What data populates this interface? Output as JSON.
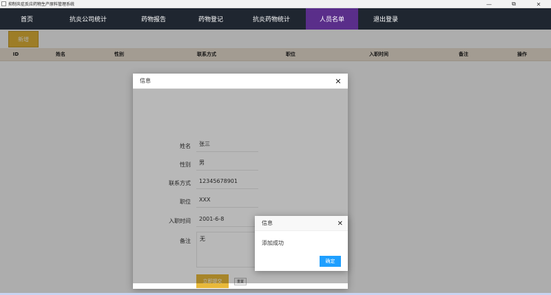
{
  "window": {
    "title": "抑制炎症反应药物生产原料管理系统",
    "controls": [
      "—",
      "⧉",
      "✕"
    ]
  },
  "nav": {
    "items": [
      {
        "label": "首页",
        "active": false
      },
      {
        "label": "抗炎公司统计",
        "active": false
      },
      {
        "label": "药物报告",
        "active": false
      },
      {
        "label": "药物登记",
        "active": false
      },
      {
        "label": "抗炎药物统计",
        "active": false
      },
      {
        "label": "人员名单",
        "active": true
      },
      {
        "label": "退出登录",
        "active": false
      }
    ],
    "active_color": "#5a2e8a"
  },
  "toolbar": {
    "add_label": "新增"
  },
  "table": {
    "headers": [
      "ID",
      "姓名",
      "性别",
      "联系方式",
      "职位",
      "入职时间",
      "备注",
      "操作"
    ]
  },
  "dialog": {
    "title": "信息",
    "fields": [
      {
        "label": "姓名",
        "value": "张三"
      },
      {
        "label": "性别",
        "value": "男"
      },
      {
        "label": "联系方式",
        "value": "12345678901"
      },
      {
        "label": "职位",
        "value": "XXX"
      },
      {
        "label": "入职时间",
        "value": "2001-6-8"
      }
    ],
    "remark": {
      "label": "备注",
      "value": "无"
    },
    "submit_label": "立即提交",
    "reset_label": "重置"
  },
  "alert": {
    "title": "信息",
    "message": "添加成功",
    "ok_label": "确定",
    "ok_color": "#1e9fff"
  },
  "colors": {
    "nav_bg": "#1f2630",
    "accent_yellow": "#e8b93a",
    "table_head_bg": "#f0e6d8"
  }
}
